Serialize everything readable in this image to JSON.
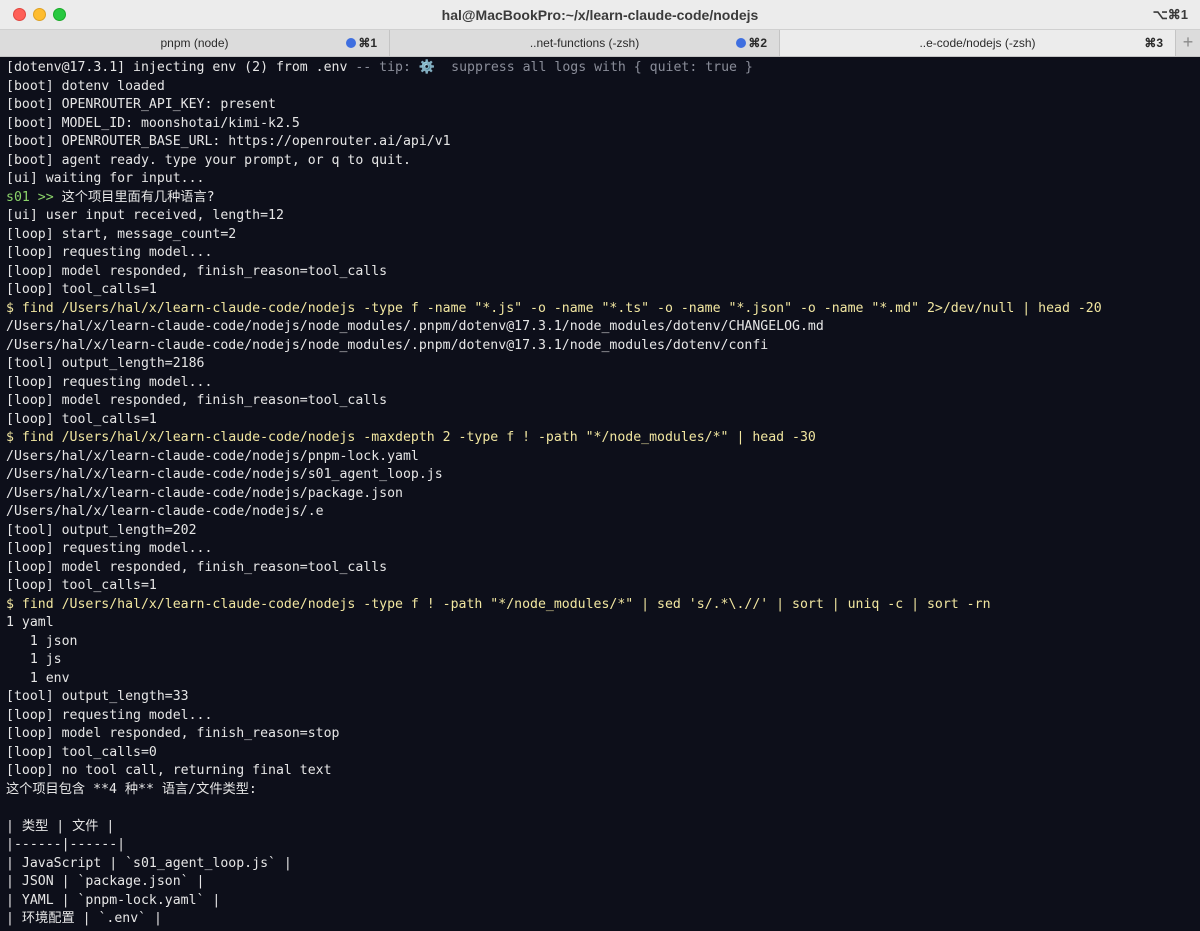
{
  "window": {
    "title": "hal@MacBookPro:~/x/learn-claude-code/nodejs",
    "shortcut": "⌥⌘1"
  },
  "tabs": [
    {
      "label": "pnpm (node)",
      "key": "⌘1",
      "has_dot": true
    },
    {
      "label": "..net-functions (-zsh)",
      "key": "⌘2",
      "has_dot": true
    },
    {
      "label": "..e-code/nodejs (-zsh)",
      "key": "⌘3",
      "has_dot": false,
      "active": true
    }
  ],
  "tab_add_label": "+",
  "colors": {
    "background": "#0d0f1a",
    "command": "#f1e6a0",
    "prompt": "#8bd36a",
    "dim": "#8a8d99",
    "tab_dot": "#3f6fe0"
  },
  "terminal": {
    "first_line": {
      "text": "[dotenv@17.3.1] injecting env (2) from .env ",
      "tip": "-- tip: ⚙️  suppress all logs with { quiet: true }"
    },
    "prompt_line": {
      "prompt": "s01 >> ",
      "text": "这个项目里面有几种语言?"
    },
    "lines_a": [
      {
        "text": "[boot] dotenv loaded",
        "style": "normal"
      },
      {
        "text": "[boot] OPENROUTER_API_KEY: present",
        "style": "normal"
      },
      {
        "text": "[boot] MODEL_ID: moonshotai/kimi-k2.5",
        "style": "normal"
      },
      {
        "text": "[boot] OPENROUTER_BASE_URL: https://openrouter.ai/api/v1",
        "style": "normal"
      },
      {
        "text": "[boot] agent ready. type your prompt, or q to quit.",
        "style": "normal"
      },
      {
        "text": "[ui] waiting for input...",
        "style": "normal"
      }
    ],
    "lines_b": [
      {
        "text": "[ui] user input received, length=12",
        "style": "normal"
      },
      {
        "text": "[loop] start, message_count=2",
        "style": "normal"
      },
      {
        "text": "[loop] requesting model...",
        "style": "normal"
      },
      {
        "text": "[loop] model responded, finish_reason=tool_calls",
        "style": "normal"
      },
      {
        "text": "[loop] tool_calls=1",
        "style": "normal"
      },
      {
        "text": "$ find /Users/hal/x/learn-claude-code/nodejs -type f -name \"*.js\" -o -name \"*.ts\" -o -name \"*.json\" -o -name \"*.md\" 2>/dev/null | head -20",
        "style": "cmd"
      },
      {
        "text": "/Users/hal/x/learn-claude-code/nodejs/node_modules/.pnpm/dotenv@17.3.1/node_modules/dotenv/CHANGELOG.md",
        "style": "normal"
      },
      {
        "text": "/Users/hal/x/learn-claude-code/nodejs/node_modules/.pnpm/dotenv@17.3.1/node_modules/dotenv/confi",
        "style": "normal"
      },
      {
        "text": "[tool] output_length=2186",
        "style": "normal"
      },
      {
        "text": "[loop] requesting model...",
        "style": "normal"
      },
      {
        "text": "[loop] model responded, finish_reason=tool_calls",
        "style": "normal"
      },
      {
        "text": "[loop] tool_calls=1",
        "style": "normal"
      },
      {
        "text": "$ find /Users/hal/x/learn-claude-code/nodejs -maxdepth 2 -type f ! -path \"*/node_modules/*\" | head -30",
        "style": "cmd"
      },
      {
        "text": "/Users/hal/x/learn-claude-code/nodejs/pnpm-lock.yaml",
        "style": "normal"
      },
      {
        "text": "/Users/hal/x/learn-claude-code/nodejs/s01_agent_loop.js",
        "style": "normal"
      },
      {
        "text": "/Users/hal/x/learn-claude-code/nodejs/package.json",
        "style": "normal"
      },
      {
        "text": "/Users/hal/x/learn-claude-code/nodejs/.e",
        "style": "normal"
      },
      {
        "text": "[tool] output_length=202",
        "style": "normal"
      },
      {
        "text": "[loop] requesting model...",
        "style": "normal"
      },
      {
        "text": "[loop] model responded, finish_reason=tool_calls",
        "style": "normal"
      },
      {
        "text": "[loop] tool_calls=1",
        "style": "normal"
      },
      {
        "text": "$ find /Users/hal/x/learn-claude-code/nodejs -type f ! -path \"*/node_modules/*\" | sed 's/.*\\.//' | sort | uniq -c | sort -rn",
        "style": "cmd"
      },
      {
        "text": "1 yaml",
        "style": "normal"
      },
      {
        "text": "   1 json",
        "style": "normal"
      },
      {
        "text": "   1 js",
        "style": "normal"
      },
      {
        "text": "   1 env",
        "style": "normal"
      },
      {
        "text": "[tool] output_length=33",
        "style": "normal"
      },
      {
        "text": "[loop] requesting model...",
        "style": "normal"
      },
      {
        "text": "[loop] model responded, finish_reason=stop",
        "style": "normal"
      },
      {
        "text": "[loop] tool_calls=0",
        "style": "normal"
      },
      {
        "text": "[loop] no tool call, returning final text",
        "style": "normal"
      },
      {
        "text": "这个项目包含 **4 种** 语言/文件类型:",
        "style": "normal"
      },
      {
        "text": "",
        "style": "normal"
      },
      {
        "text": "| 类型 | 文件 |",
        "style": "normal"
      },
      {
        "text": "|------|------|",
        "style": "normal"
      },
      {
        "text": "| JavaScript | `s01_agent_loop.js` |",
        "style": "normal"
      },
      {
        "text": "| JSON | `package.json` |",
        "style": "normal"
      },
      {
        "text": "| YAML | `pnpm-lock.yaml` |",
        "style": "normal"
      },
      {
        "text": "| 环境配置 | `.env` |",
        "style": "normal"
      }
    ]
  }
}
